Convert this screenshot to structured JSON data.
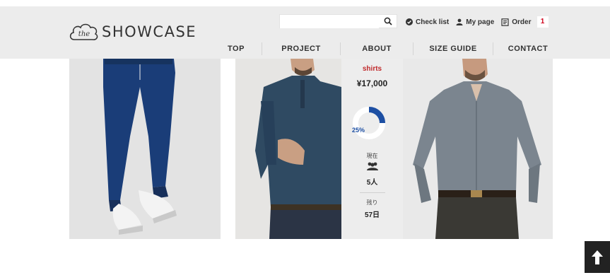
{
  "brand": {
    "logo_mark": "the",
    "name": "SHOWCASE"
  },
  "search": {
    "placeholder": ""
  },
  "utility": {
    "check_list": "Check list",
    "my_page": "My page",
    "order": "Order",
    "order_count": "1"
  },
  "nav": [
    "TOP",
    "PROJECT",
    "ABOUT",
    "SIZE GUIDE",
    "CONTACT"
  ],
  "product": {
    "category": "shirts",
    "price": "¥17,000",
    "progress_percent": 25,
    "progress_label": "25%",
    "current_label": "現在",
    "current_value": "5人",
    "remaining_label": "残り",
    "remaining_value": "57日"
  },
  "colors": {
    "header_bg": "#ececec",
    "accent_red": "#c0292b",
    "progress_blue": "#1d4fa3"
  }
}
